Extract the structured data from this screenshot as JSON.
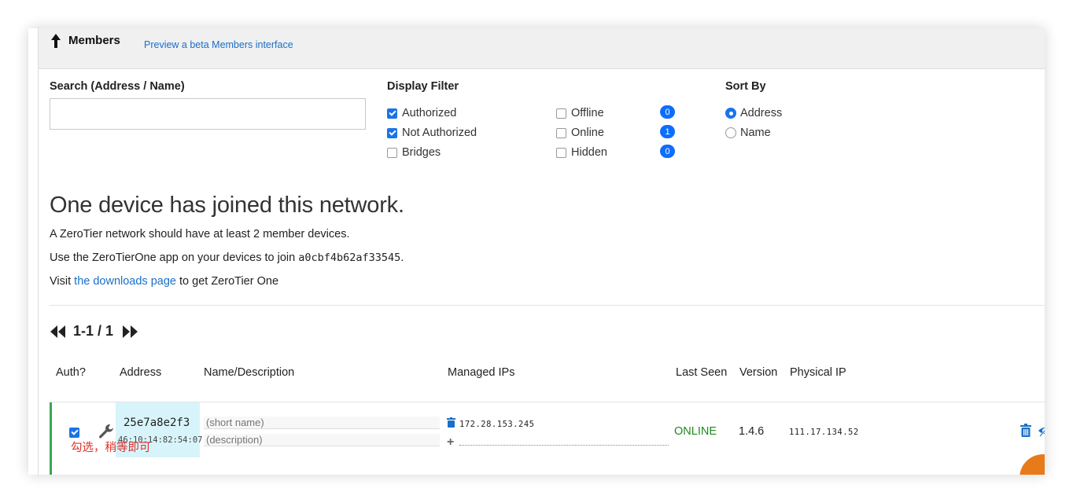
{
  "header": {
    "title": "Members",
    "beta_link": "Preview a beta Members interface"
  },
  "search": {
    "label": "Search (Address / Name)",
    "value": "",
    "placeholder": ""
  },
  "display_filter": {
    "label": "Display Filter",
    "authorized": "Authorized",
    "not_authorized": "Not Authorized",
    "bridges": "Bridges",
    "offline": "Offline",
    "online": "Online",
    "hidden": "Hidden",
    "offline_count": "0",
    "online_count": "1",
    "hidden_count": "0"
  },
  "sort": {
    "label": "Sort By",
    "address": "Address",
    "name": "Name"
  },
  "info": {
    "heading": "One device has joined this network.",
    "line1": "A ZeroTier network should have at least 2 member devices.",
    "line2_prefix": "Use the ZeroTierOne app on your devices to join ",
    "network_id": "a0cbf4b62af33545",
    "line2_suffix": ".",
    "line3_prefix": "Visit ",
    "downloads_link": "the downloads page",
    "line3_suffix": " to get ZeroTier One"
  },
  "pager": {
    "text": "1-1 / 1"
  },
  "columns": {
    "auth": "Auth?",
    "address": "Address",
    "name": "Name/Description",
    "managed_ips": "Managed IPs",
    "last_seen": "Last Seen",
    "version": "Version",
    "physical_ip": "Physical IP"
  },
  "member": {
    "address": "25e7a8e2f3",
    "mac": "46:10:14:82:54:07",
    "short_name_placeholder": "(short name)",
    "description_placeholder": "(description)",
    "managed_ip": "172.28.153.245",
    "last_seen": "ONLINE",
    "version": "1.4.6",
    "physical_ip": "111.17.134.52",
    "annotation": "勾选，稍等即可"
  }
}
